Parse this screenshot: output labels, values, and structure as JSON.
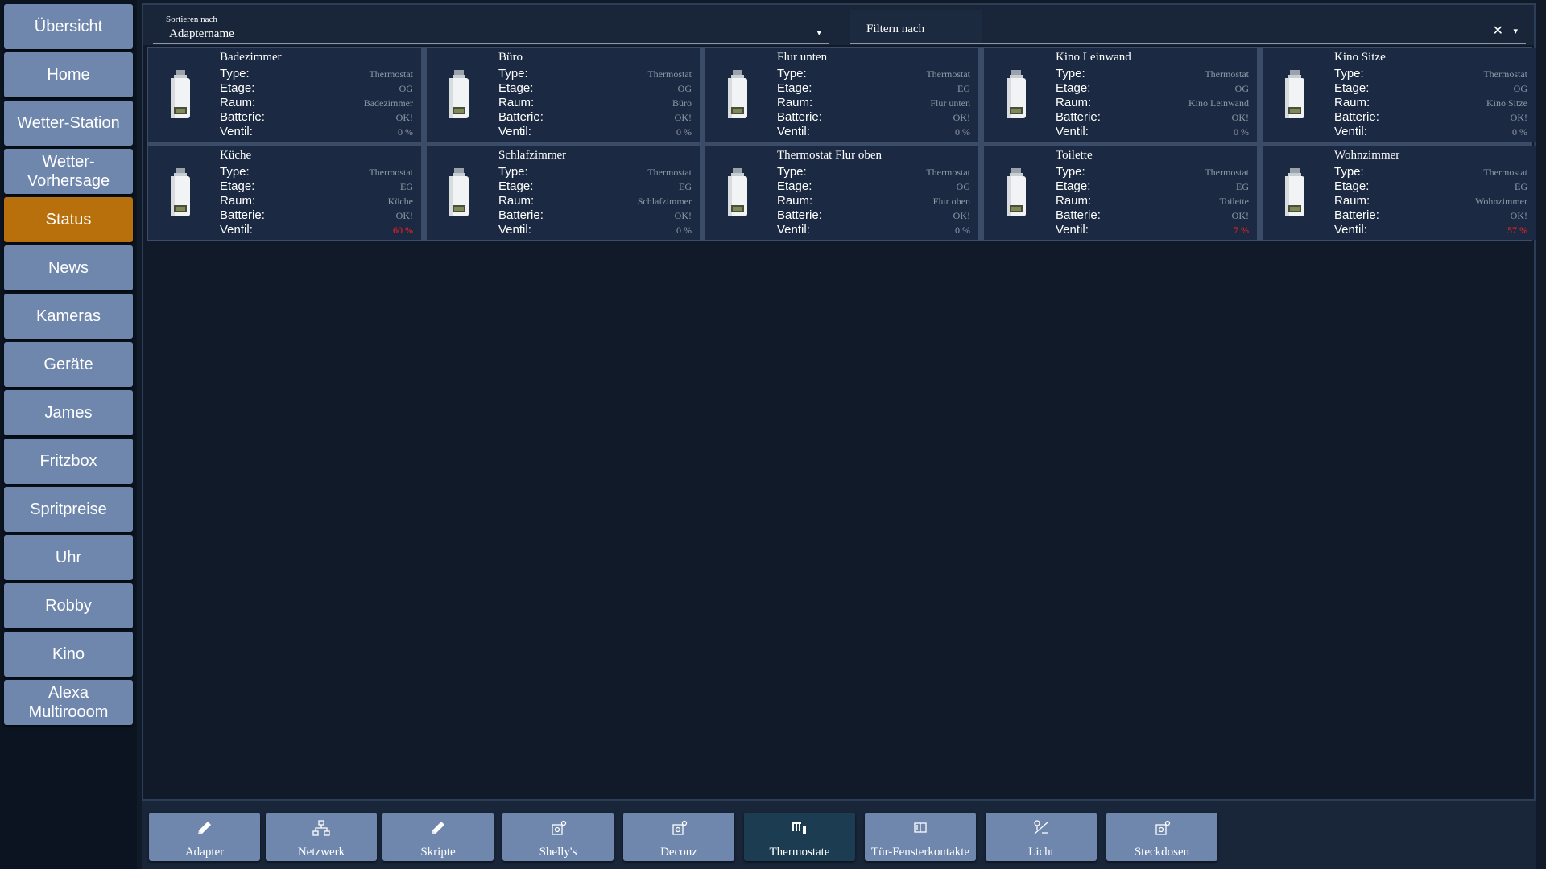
{
  "sidebar": {
    "items": [
      {
        "label": "Übersicht"
      },
      {
        "label": "Home"
      },
      {
        "label": "Wetter-Station"
      },
      {
        "label": "Wetter-\nVorhersage"
      },
      {
        "label": "Status",
        "active": true
      },
      {
        "label": "News"
      },
      {
        "label": "Kameras"
      },
      {
        "label": "Geräte"
      },
      {
        "label": "James"
      },
      {
        "label": "Fritzbox"
      },
      {
        "label": "Spritpreise"
      },
      {
        "label": "Uhr"
      },
      {
        "label": "Robby"
      },
      {
        "label": "Kino"
      },
      {
        "label": "Alexa\nMultirooom"
      }
    ]
  },
  "toolbar": {
    "sort_caption": "Sortieren nach",
    "sort_value": "Adaptername",
    "filter_label": "Filtern nach",
    "filter_value": "",
    "clear_glyph": "✕",
    "arrow_glyph": "▾"
  },
  "labels": {
    "type": "Type:",
    "etage": "Etage:",
    "raum": "Raum:",
    "batterie": "Batterie:",
    "ventil": "Ventil:"
  },
  "devices": [
    {
      "name": "Badezimmer",
      "type": "Thermostat",
      "etage": "OG",
      "raum": "Badezimmer",
      "batterie": "OK!",
      "ventil": "0 %",
      "ventil_alert": false
    },
    {
      "name": "Büro",
      "type": "Thermostat",
      "etage": "OG",
      "raum": "Büro",
      "batterie": "OK!",
      "ventil": "0 %",
      "ventil_alert": false
    },
    {
      "name": "Flur unten",
      "type": "Thermostat",
      "etage": "EG",
      "raum": "Flur unten",
      "batterie": "OK!",
      "ventil": "0 %",
      "ventil_alert": false
    },
    {
      "name": "Kino Leinwand",
      "type": "Thermostat",
      "etage": "OG",
      "raum": "Kino Leinwand",
      "batterie": "OK!",
      "ventil": "0 %",
      "ventil_alert": false
    },
    {
      "name": "Kino Sitze",
      "type": "Thermostat",
      "etage": "OG",
      "raum": "Kino Sitze",
      "batterie": "OK!",
      "ventil": "0 %",
      "ventil_alert": false
    },
    {
      "name": "Küche",
      "type": "Thermostat",
      "etage": "EG",
      "raum": "Küche",
      "batterie": "OK!",
      "ventil": "60 %",
      "ventil_alert": true
    },
    {
      "name": "Schlafzimmer",
      "type": "Thermostat",
      "etage": "EG",
      "raum": "Schlafzimmer",
      "batterie": "OK!",
      "ventil": "0 %",
      "ventil_alert": false
    },
    {
      "name": "Thermostat Flur oben",
      "type": "Thermostat",
      "etage": "OG",
      "raum": "Flur oben",
      "batterie": "OK!",
      "ventil": "0 %",
      "ventil_alert": false
    },
    {
      "name": "Toilette",
      "type": "Thermostat",
      "etage": "EG",
      "raum": "Toilette",
      "batterie": "OK!",
      "ventil": "7 %",
      "ventil_alert": true
    },
    {
      "name": "Wohnzimmer",
      "type": "Thermostat",
      "etage": "EG",
      "raum": "Wohnzimmer",
      "batterie": "OK!",
      "ventil": "57 %",
      "ventil_alert": true
    }
  ],
  "footer": {
    "buttons": [
      {
        "label": "Adapter",
        "icon": "pencil-icon"
      },
      {
        "label": "Netzwerk",
        "icon": "network-icon"
      },
      {
        "label": "Skripte",
        "icon": "pencil-icon"
      },
      {
        "label": "Shelly's",
        "icon": "device-icon"
      },
      {
        "label": "Deconz",
        "icon": "device-icon"
      },
      {
        "label": "Thermostate",
        "icon": "thermostat-icon",
        "active": true
      },
      {
        "label": "Tür-Fensterkontakte",
        "icon": "window-icon"
      },
      {
        "label": "Licht",
        "icon": "light-icon"
      },
      {
        "label": "Steckdosen",
        "icon": "device-icon"
      }
    ]
  },
  "colors": {
    "accent_active": "#b8700c",
    "button": "#6f87ad",
    "alert": "#ff2020"
  }
}
